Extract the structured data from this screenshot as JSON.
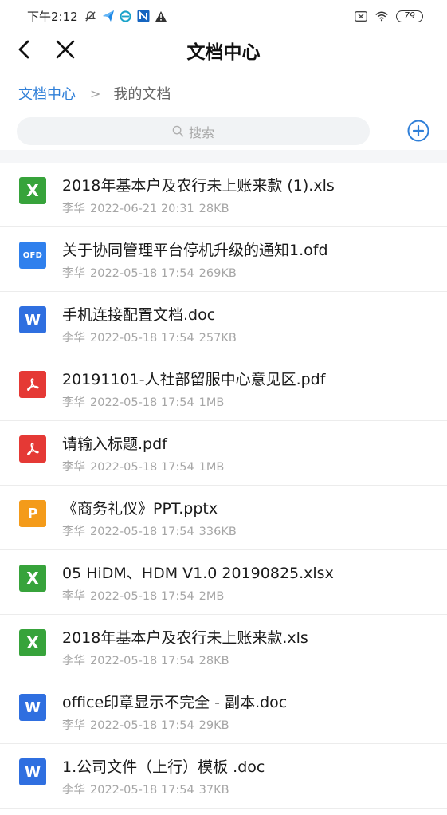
{
  "status_bar": {
    "time": "下午2:12",
    "battery": "79"
  },
  "nav": {
    "title": "文档中心"
  },
  "breadcrumb": {
    "root": "文档中心",
    "separator": ">",
    "current": "我的文档"
  },
  "search": {
    "placeholder": "搜索"
  },
  "colors": {
    "accent": "#2f7fd8",
    "xls": "#37a33b",
    "doc": "#2f6fe0",
    "pdf": "#e53935",
    "ppt": "#f49b1a",
    "ofd": "#2f80ed"
  },
  "files": [
    {
      "type": "xls",
      "icon_label": "X",
      "name": "2018年基本户及农行未上账来款 (1).xls",
      "owner": "李华",
      "datetime": "2022-06-21 20:31",
      "size": "28KB"
    },
    {
      "type": "ofd",
      "icon_label": "OFD",
      "name": "关于协同管理平台停机升级的通知1.ofd",
      "owner": "李华",
      "datetime": "2022-05-18 17:54",
      "size": "269KB"
    },
    {
      "type": "doc",
      "icon_label": "W",
      "name": "手机连接配置文档.doc",
      "owner": "李华",
      "datetime": "2022-05-18 17:54",
      "size": "257KB"
    },
    {
      "type": "pdf",
      "icon_label": "pdf-icon",
      "name": "20191101-人社部留服中心意见区.pdf",
      "owner": "李华",
      "datetime": "2022-05-18 17:54",
      "size": "1MB"
    },
    {
      "type": "pdf",
      "icon_label": "pdf-icon",
      "name": "请输入标题.pdf",
      "owner": "李华",
      "datetime": "2022-05-18 17:54",
      "size": "1MB"
    },
    {
      "type": "ppt",
      "icon_label": "P",
      "name": "《商务礼仪》PPT.pptx",
      "owner": "李华",
      "datetime": "2022-05-18 17:54",
      "size": "336KB"
    },
    {
      "type": "xls",
      "icon_label": "X",
      "name": "05 HiDM、HDM V1.0 20190825.xlsx",
      "owner": "李华",
      "datetime": "2022-05-18 17:54",
      "size": "2MB"
    },
    {
      "type": "xls",
      "icon_label": "X",
      "name": "2018年基本户及农行未上账来款.xls",
      "owner": "李华",
      "datetime": "2022-05-18 17:54",
      "size": "28KB"
    },
    {
      "type": "doc",
      "icon_label": "W",
      "name": "office印章显示不完全 - 副本.doc",
      "owner": "李华",
      "datetime": "2022-05-18 17:54",
      "size": "29KB"
    },
    {
      "type": "doc",
      "icon_label": "W",
      "name": "1.公司文件（上行）模板 .doc",
      "owner": "李华",
      "datetime": "2022-05-18 17:54",
      "size": "37KB"
    }
  ]
}
